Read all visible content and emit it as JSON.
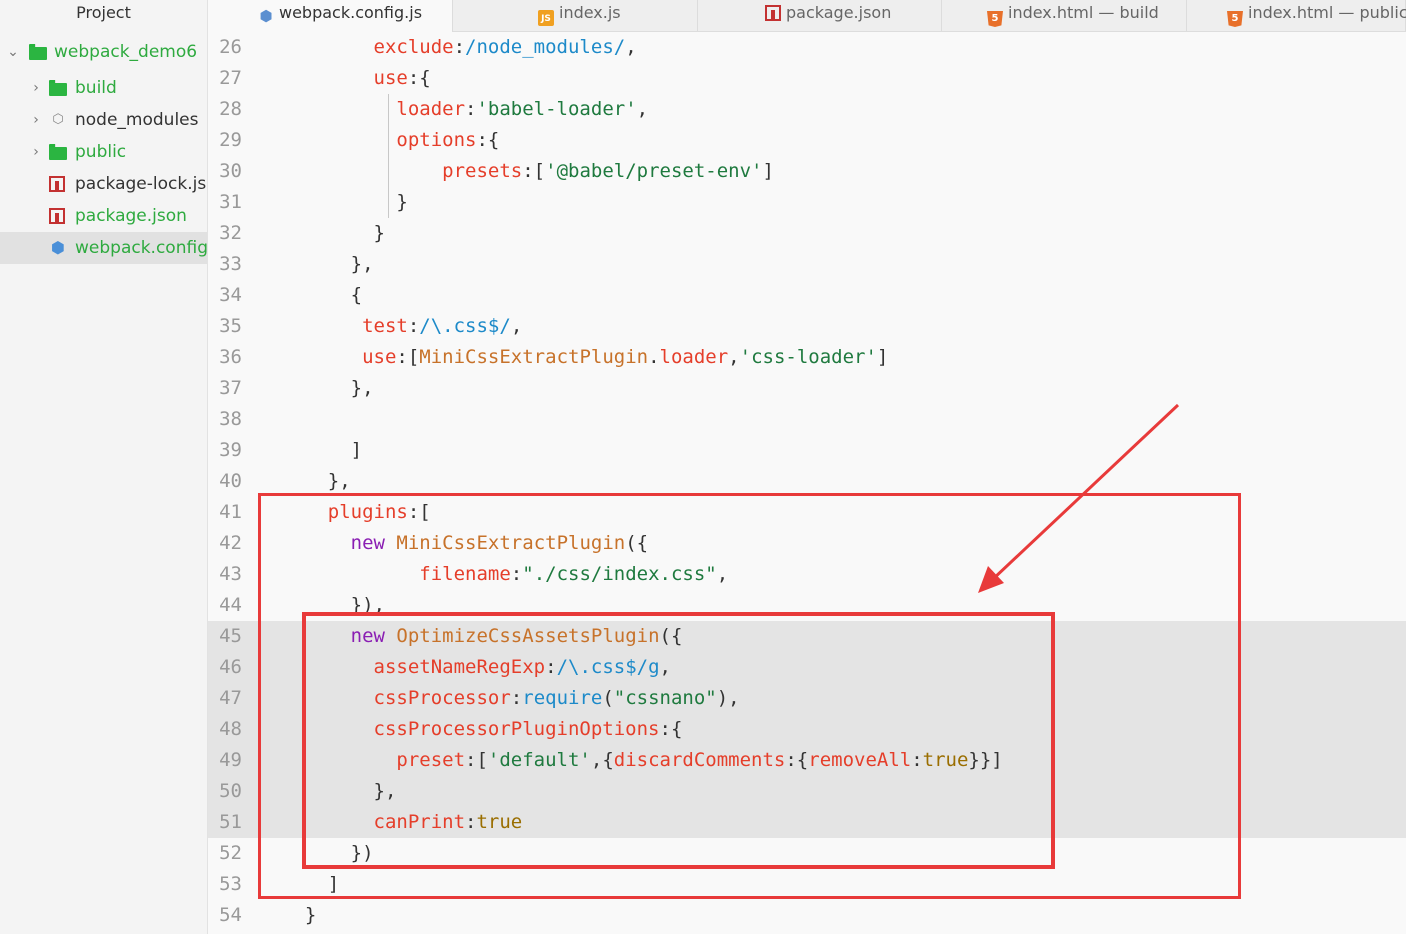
{
  "sidebar": {
    "header": "Project",
    "root": {
      "label": "webpack_demo6",
      "expanded": true
    },
    "items": [
      {
        "label": "build",
        "kind": "folder",
        "icon": "folder-icon"
      },
      {
        "label": "node_modules",
        "kind": "folder",
        "icon": "node-modules-icon"
      },
      {
        "label": "public",
        "kind": "folder",
        "icon": "folder-icon"
      },
      {
        "label": "package-lock.jso",
        "kind": "file",
        "icon": "npm-icon"
      },
      {
        "label": "package.json",
        "kind": "file",
        "icon": "npm-icon"
      },
      {
        "label": "webpack.config.j",
        "kind": "file",
        "icon": "webpack-icon",
        "selected": true
      }
    ]
  },
  "tabs": [
    {
      "label": "webpack.config.js",
      "icon": "webpack-icon",
      "active": true
    },
    {
      "label": "index.js",
      "icon": "js-icon"
    },
    {
      "label": "package.json",
      "icon": "npm-icon"
    },
    {
      "label": "index.html — build",
      "icon": "html5-icon"
    },
    {
      "label": "index.html — public",
      "icon": "html5-icon"
    }
  ],
  "editor": {
    "lines": [
      {
        "num": "26",
        "tokens": [
          [
            "        ",
            ""
          ],
          [
            "exclude",
            "k"
          ],
          [
            ":",
            ""
          ],
          [
            "/node_modules/",
            "blue"
          ],
          [
            ",",
            ""
          ]
        ]
      },
      {
        "num": "27",
        "tokens": [
          [
            "        ",
            ""
          ],
          [
            "use",
            "k"
          ],
          [
            ":{",
            ""
          ]
        ]
      },
      {
        "num": "28",
        "tokens": [
          [
            "          ",
            ""
          ],
          [
            "loader",
            "k"
          ],
          [
            ":",
            ""
          ],
          [
            "'babel-loader'",
            "s"
          ],
          [
            ",",
            ""
          ]
        ]
      },
      {
        "num": "29",
        "tokens": [
          [
            "          ",
            ""
          ],
          [
            "options",
            "k"
          ],
          [
            ":{",
            ""
          ]
        ]
      },
      {
        "num": "30",
        "tokens": [
          [
            "              ",
            ""
          ],
          [
            "presets",
            "k"
          ],
          [
            ":[",
            ""
          ],
          [
            "'@babel/preset-env'",
            "s"
          ],
          [
            "]",
            ""
          ]
        ]
      },
      {
        "num": "31",
        "tokens": [
          [
            "          ",
            ""
          ],
          [
            "}",
            ""
          ]
        ]
      },
      {
        "num": "32",
        "tokens": [
          [
            "        ",
            ""
          ],
          [
            "}",
            ""
          ]
        ]
      },
      {
        "num": "33",
        "tokens": [
          [
            "      ",
            ""
          ],
          [
            "},",
            ""
          ]
        ]
      },
      {
        "num": "34",
        "tokens": [
          [
            "      ",
            ""
          ],
          [
            "{",
            ""
          ]
        ]
      },
      {
        "num": "35",
        "tokens": [
          [
            "       ",
            ""
          ],
          [
            "test",
            "k"
          ],
          [
            ":",
            ""
          ],
          [
            "/\\.css$/",
            "blue"
          ],
          [
            ",",
            ""
          ]
        ]
      },
      {
        "num": "36",
        "tokens": [
          [
            "       ",
            ""
          ],
          [
            "use",
            "k"
          ],
          [
            ":[",
            ""
          ],
          [
            "MiniCssExtractPlugin",
            "fn"
          ],
          [
            ".",
            ""
          ],
          [
            "loader",
            "k"
          ],
          [
            ",",
            ""
          ],
          [
            "'css-loader'",
            "s"
          ],
          [
            "]",
            ""
          ]
        ]
      },
      {
        "num": "37",
        "tokens": [
          [
            "      ",
            ""
          ],
          [
            "},",
            ""
          ]
        ]
      },
      {
        "num": "38",
        "tokens": []
      },
      {
        "num": "39",
        "tokens": [
          [
            "      ",
            ""
          ],
          [
            "]",
            ""
          ]
        ]
      },
      {
        "num": "40",
        "tokens": [
          [
            "    ",
            ""
          ],
          [
            "},",
            ""
          ]
        ]
      },
      {
        "num": "41",
        "tokens": [
          [
            "    ",
            ""
          ],
          [
            "plugins",
            "k"
          ],
          [
            ":[",
            ""
          ]
        ]
      },
      {
        "num": "42",
        "tokens": [
          [
            "      ",
            ""
          ],
          [
            "new",
            "kw"
          ],
          [
            " ",
            ""
          ],
          [
            "MiniCssExtractPlugin",
            "fn"
          ],
          [
            "({",
            ""
          ]
        ]
      },
      {
        "num": "43",
        "tokens": [
          [
            "            ",
            ""
          ],
          [
            "filename",
            "k"
          ],
          [
            ":",
            ""
          ],
          [
            "\"./css/index.css\"",
            "s"
          ],
          [
            ",",
            ""
          ]
        ]
      },
      {
        "num": "44",
        "tokens": [
          [
            "      ",
            ""
          ],
          [
            "}),",
            ""
          ]
        ]
      },
      {
        "num": "45",
        "tokens": [
          [
            "      ",
            ""
          ],
          [
            "new",
            "kw"
          ],
          [
            " ",
            ""
          ],
          [
            "OptimizeCssAssetsPlugin",
            "fn"
          ],
          [
            "({",
            ""
          ]
        ]
      },
      {
        "num": "46",
        "tokens": [
          [
            "        ",
            ""
          ],
          [
            "assetNameRegExp",
            "k"
          ],
          [
            ":",
            ""
          ],
          [
            "/\\.css$/g",
            "blue"
          ],
          [
            ",",
            ""
          ]
        ]
      },
      {
        "num": "47",
        "tokens": [
          [
            "        ",
            ""
          ],
          [
            "cssProcessor",
            "k"
          ],
          [
            ":",
            ""
          ],
          [
            "require",
            "blue"
          ],
          [
            "(",
            ""
          ],
          [
            "\"cssnano\"",
            "s"
          ],
          [
            "),",
            ""
          ]
        ]
      },
      {
        "num": "48",
        "tokens": [
          [
            "        ",
            ""
          ],
          [
            "cssProcessorPluginOptions",
            "k"
          ],
          [
            ":{",
            ""
          ]
        ]
      },
      {
        "num": "49",
        "tokens": [
          [
            "          ",
            ""
          ],
          [
            "preset",
            "k"
          ],
          [
            ":[",
            ""
          ],
          [
            "'default'",
            "s"
          ],
          [
            ",{",
            ""
          ],
          [
            "discardComments",
            "k"
          ],
          [
            ":{",
            ""
          ],
          [
            "removeAll",
            "k"
          ],
          [
            ":",
            ""
          ],
          [
            "true",
            "bool"
          ],
          [
            "}}]",
            ""
          ]
        ]
      },
      {
        "num": "50",
        "tokens": [
          [
            "        ",
            ""
          ],
          [
            "},",
            ""
          ]
        ]
      },
      {
        "num": "51",
        "tokens": [
          [
            "        ",
            ""
          ],
          [
            "canPrint",
            "k"
          ],
          [
            ":",
            ""
          ],
          [
            "true",
            "bool"
          ]
        ]
      },
      {
        "num": "52",
        "tokens": [
          [
            "      ",
            ""
          ],
          [
            "})",
            ""
          ]
        ]
      },
      {
        "num": "53",
        "tokens": [
          [
            "    ",
            ""
          ],
          [
            "]",
            ""
          ]
        ]
      },
      {
        "num": "54",
        "tokens": [
          [
            "  ",
            ""
          ],
          [
            "}",
            ""
          ]
        ]
      }
    ],
    "highlighted_lines": [
      "45",
      "46",
      "47",
      "48",
      "49",
      "50",
      "51"
    ]
  },
  "annotation": {
    "color": "#e83a3a"
  }
}
